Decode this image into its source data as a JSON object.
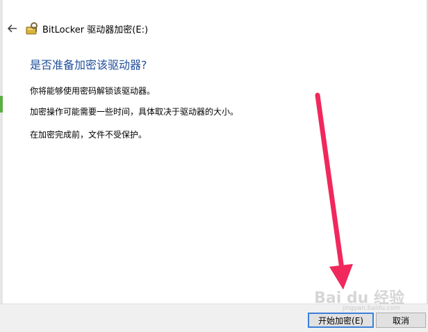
{
  "titlebar": {
    "back_icon": "back-arrow-icon",
    "app_icon": "bitlocker-key-icon",
    "title": "BitLocker 驱动器加密(E:)"
  },
  "content": {
    "heading": "是否准备加密该驱动器?",
    "paragraphs": [
      "你将能够使用密码解锁该驱动器。",
      "加密操作可能需要一些时间，具体取决于驱动器的大小。",
      "在加密完成前，文件不受保护。"
    ]
  },
  "footer": {
    "start_label": "开始加密(E)",
    "cancel_label": "取消"
  },
  "watermark": {
    "text": "Bai du 经验",
    "sub": "jingyan.baidu.com"
  },
  "colors": {
    "heading": "#1f4e9c",
    "arrow": "#f0285c",
    "focus_border": "#3c7fd9"
  }
}
